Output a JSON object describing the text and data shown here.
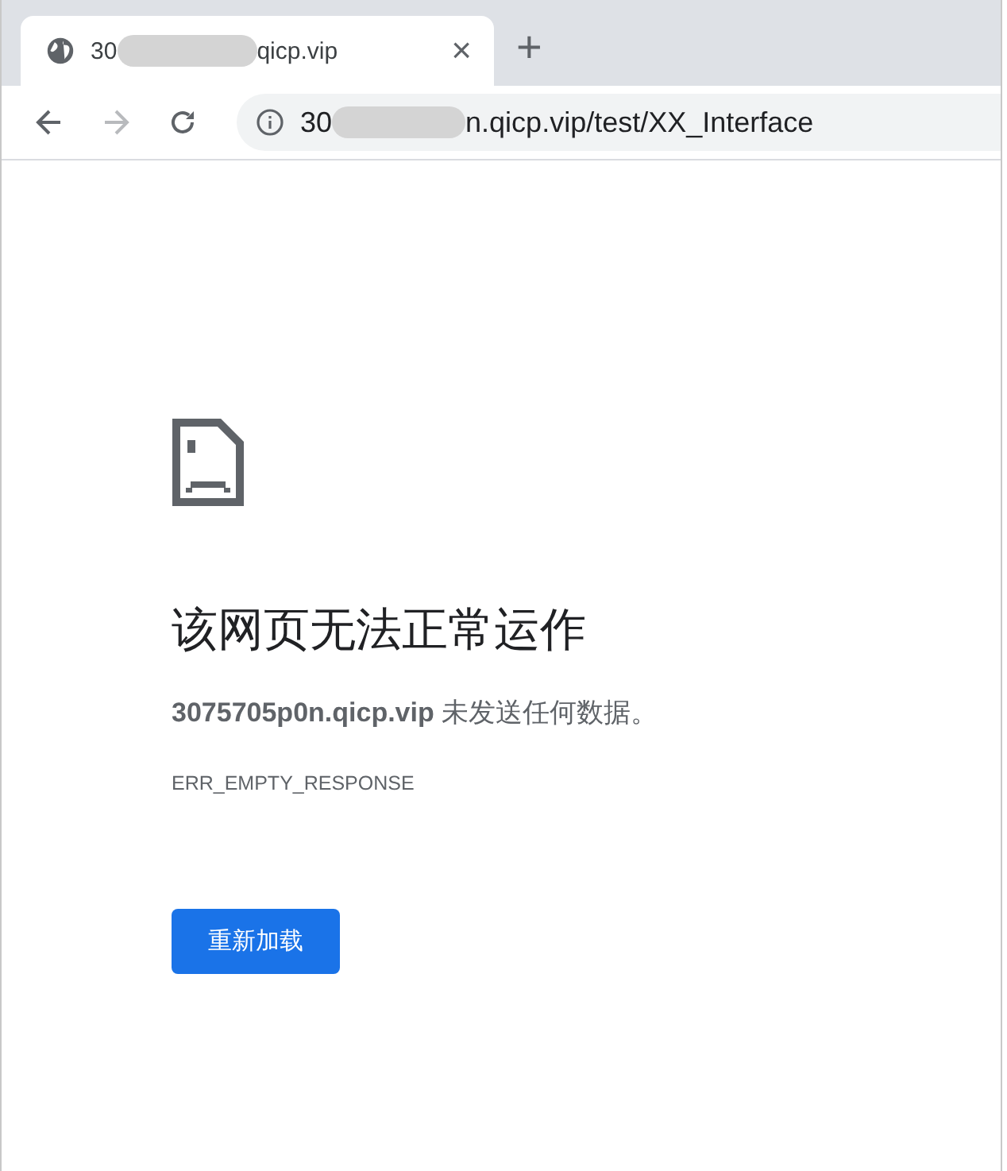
{
  "tab": {
    "title_start": "30",
    "title_end": "qicp.vip",
    "close": "×",
    "selected": true
  },
  "new_tab": "+",
  "address": {
    "url_start": "30",
    "url_end": "n.qicp.vip/test/XX_Interface"
  },
  "nav": {
    "back_disabled": false,
    "forward_disabled": true
  },
  "error": {
    "title": "该网页无法正常运作",
    "message": "**3075705p0n.qicp.vip** 未发送任何数据。",
    "code": "ERR_EMPTY_RESPONSE",
    "button": "重新加载"
  }
}
